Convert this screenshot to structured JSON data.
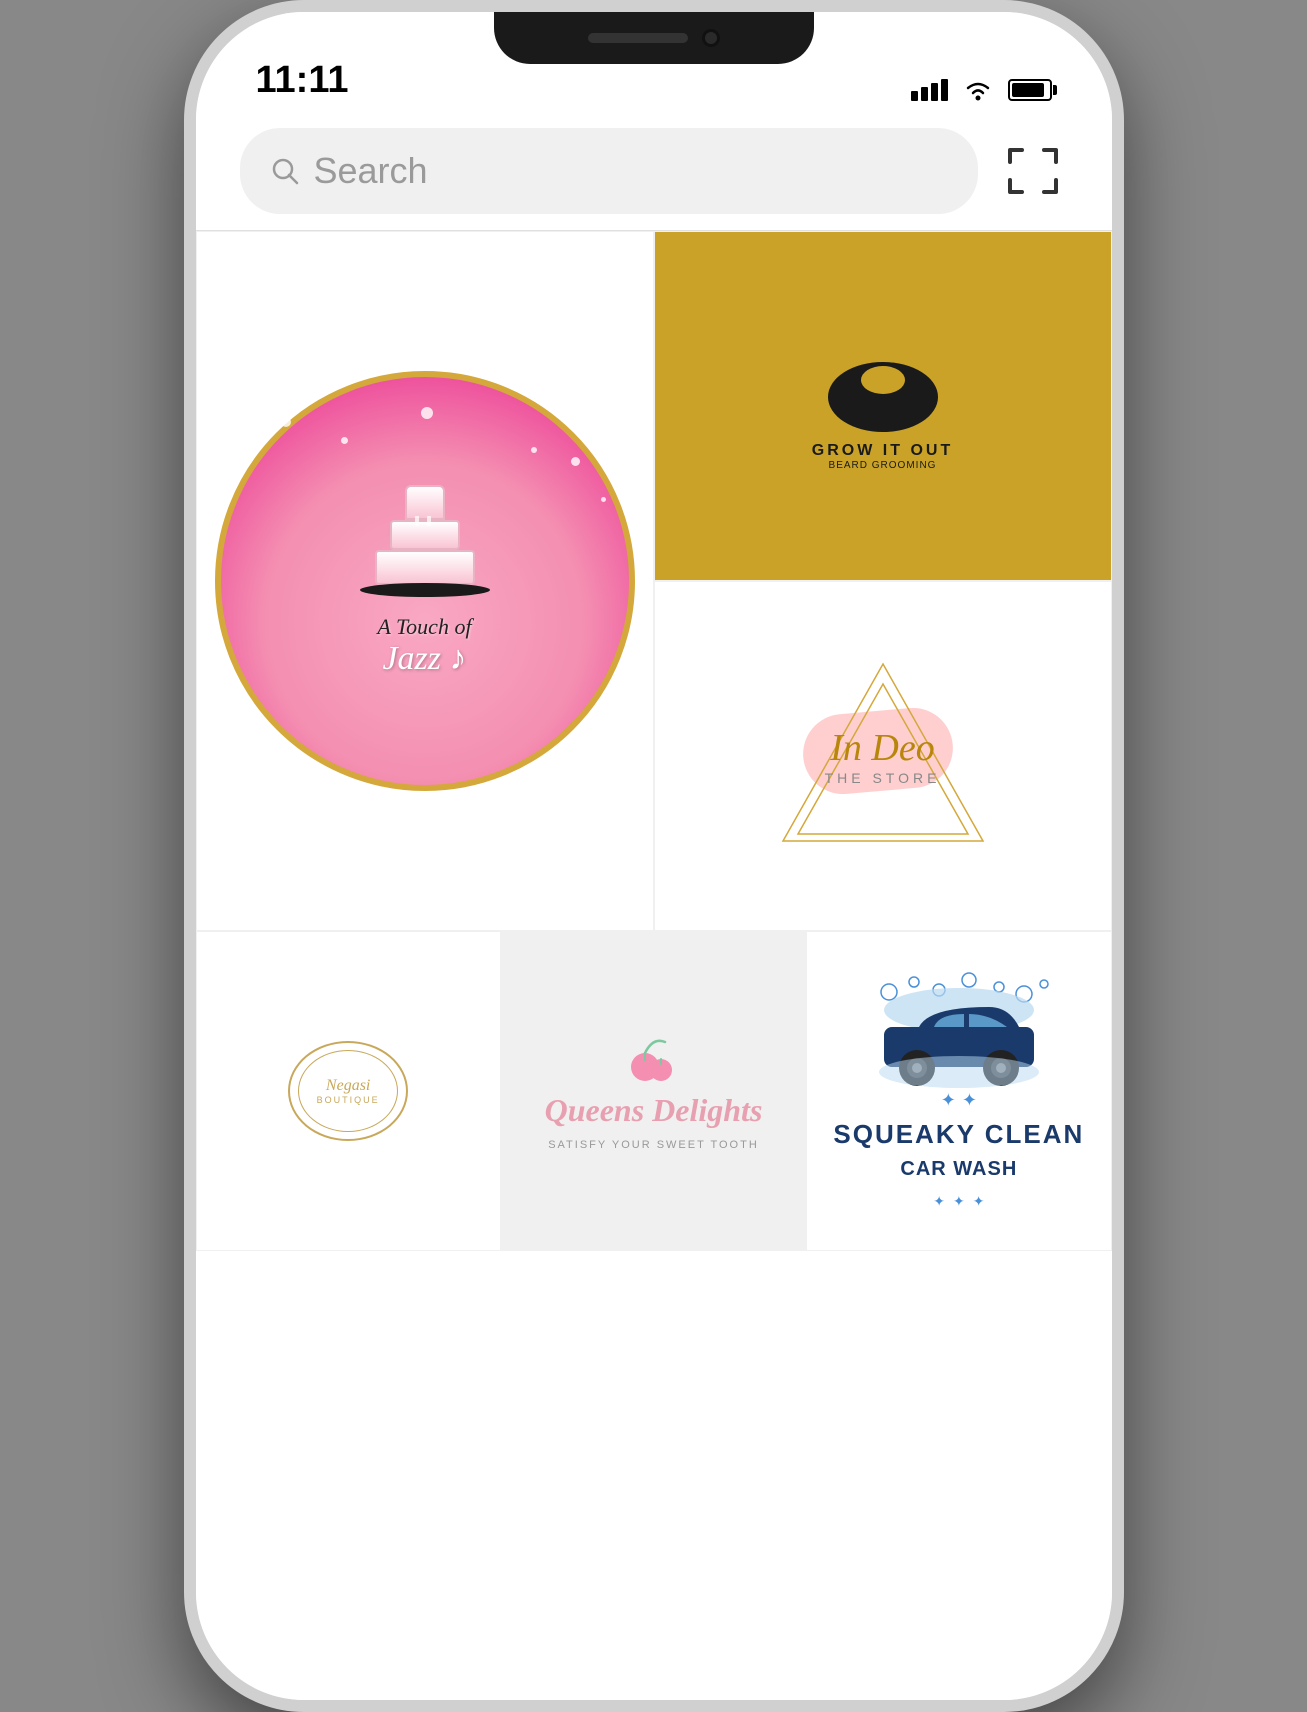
{
  "phone": {
    "status_bar": {
      "time": "11:11",
      "signal_label": "signal",
      "wifi_label": "wifi",
      "battery_label": "battery"
    },
    "search": {
      "placeholder": "Search",
      "scan_label": "scan"
    },
    "grid": {
      "items": [
        {
          "id": "touch-of-jazz",
          "name": "A Touch of Jazz",
          "type": "cake-bakery-logo",
          "size": "large"
        },
        {
          "id": "grow-it-out",
          "name": "Grow It Out",
          "type": "beard-grooming-logo",
          "bg_color": "#c9a227",
          "size": "small"
        },
        {
          "id": "in-deo",
          "name": "In Deo The Store",
          "type": "boutique-logo",
          "size": "small"
        },
        {
          "id": "negasi-boutique",
          "name": "Negasi Boutique",
          "type": "boutique-logo",
          "size": "small"
        },
        {
          "id": "queens-delights",
          "name": "Queens Delights",
          "subtitle": "Satisfy Your Sweet Tooth",
          "type": "bakery-logo",
          "size": "small",
          "bg_color": "#f5f5f5"
        },
        {
          "id": "squeaky-clean",
          "name": "Squeaky Clean Car Wash",
          "type": "carwash-logo",
          "size": "small"
        }
      ]
    }
  }
}
